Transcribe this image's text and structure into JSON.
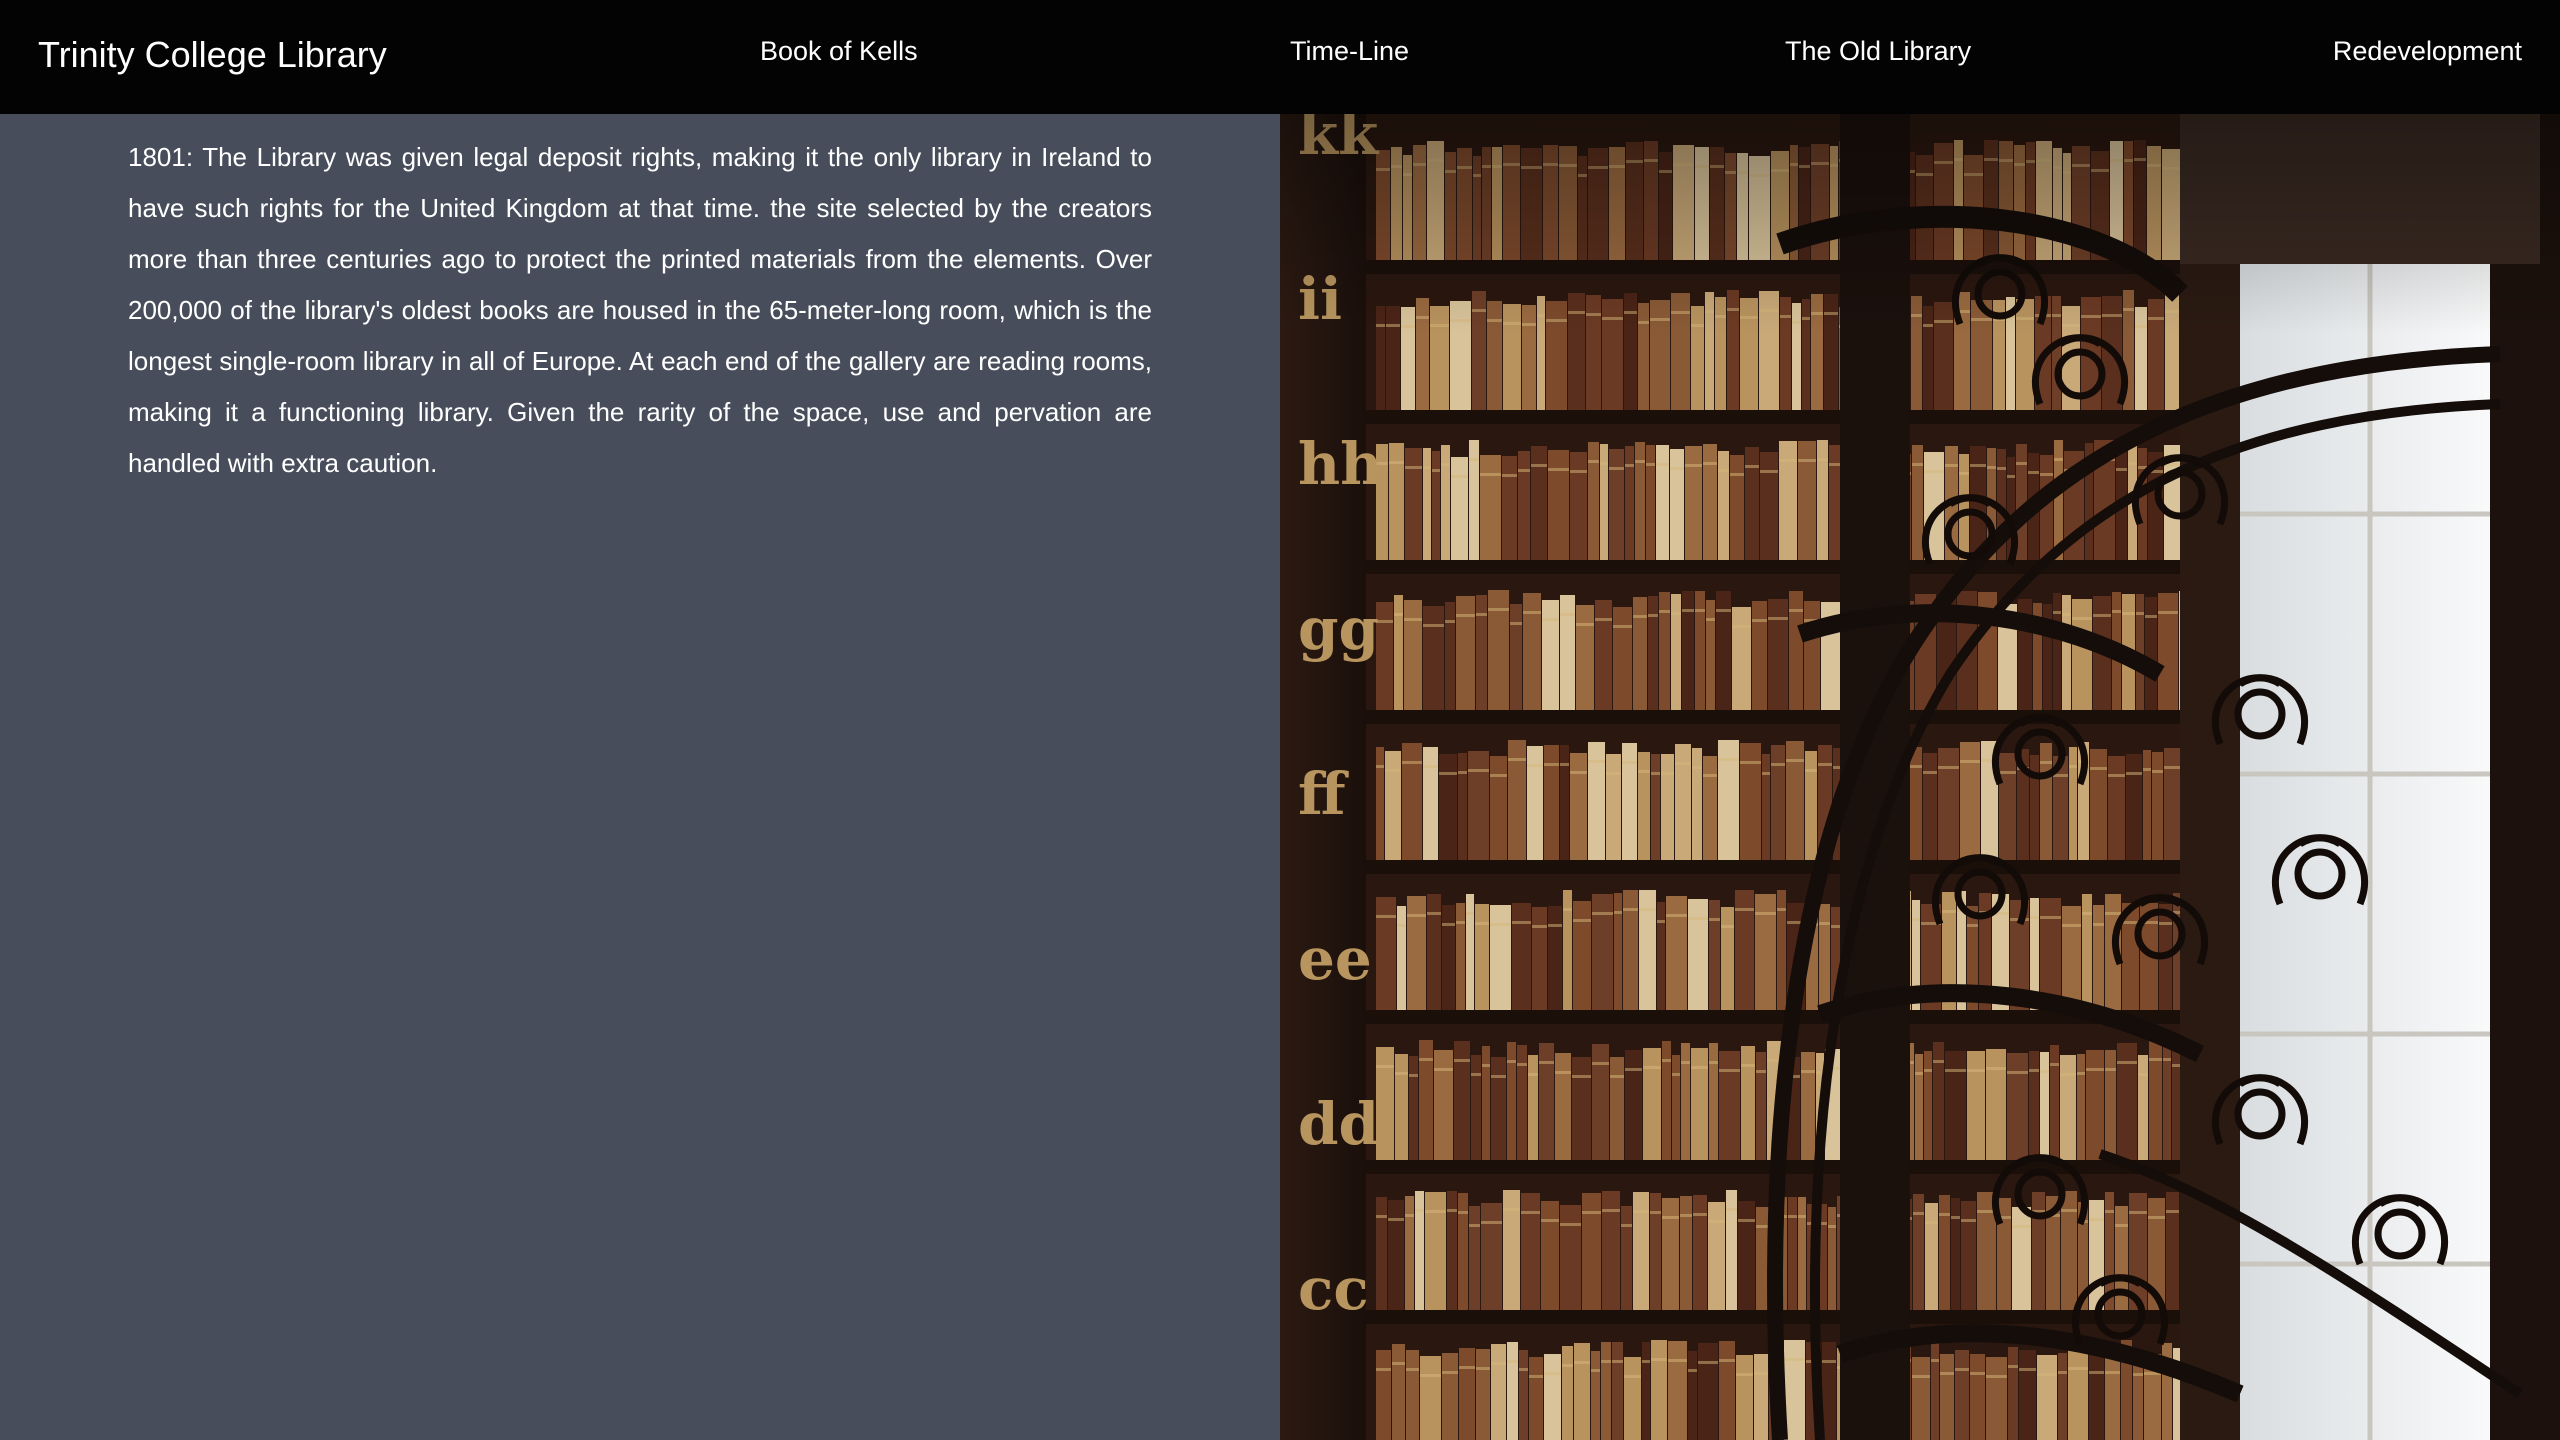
{
  "header": {
    "site_title": "Trinity College Library",
    "nav": [
      {
        "label": "Book of Kells"
      },
      {
        "label": "Time-Line"
      },
      {
        "label": "The Old Library"
      },
      {
        "label": "Redevelopment"
      }
    ]
  },
  "main": {
    "paragraph": "1801: The Library was given legal deposit rights, making it the only library in Ireland to have such rights for the United Kingdom at that time. the site selected by the creators more than three centuries ago to protect the printed materials from the elements. Over 200,000 of the library's oldest books are housed in the 65-meter-long room, which is the longest single-room library in all of Europe. At each end of the gallery are reading rooms, making it a functioning library. Given the rarity of the space, use and pervation are handled with extra caution."
  },
  "photo": {
    "subject": "library-bookshelves-spiral-staircase",
    "shelf_letters": [
      "kk",
      "ii",
      "hh",
      "gg",
      "ff",
      "ee",
      "dd",
      "cc"
    ]
  },
  "colors": {
    "header_bg": "#030303",
    "content_bg": "#474d5b",
    "text": "#ffffff"
  }
}
